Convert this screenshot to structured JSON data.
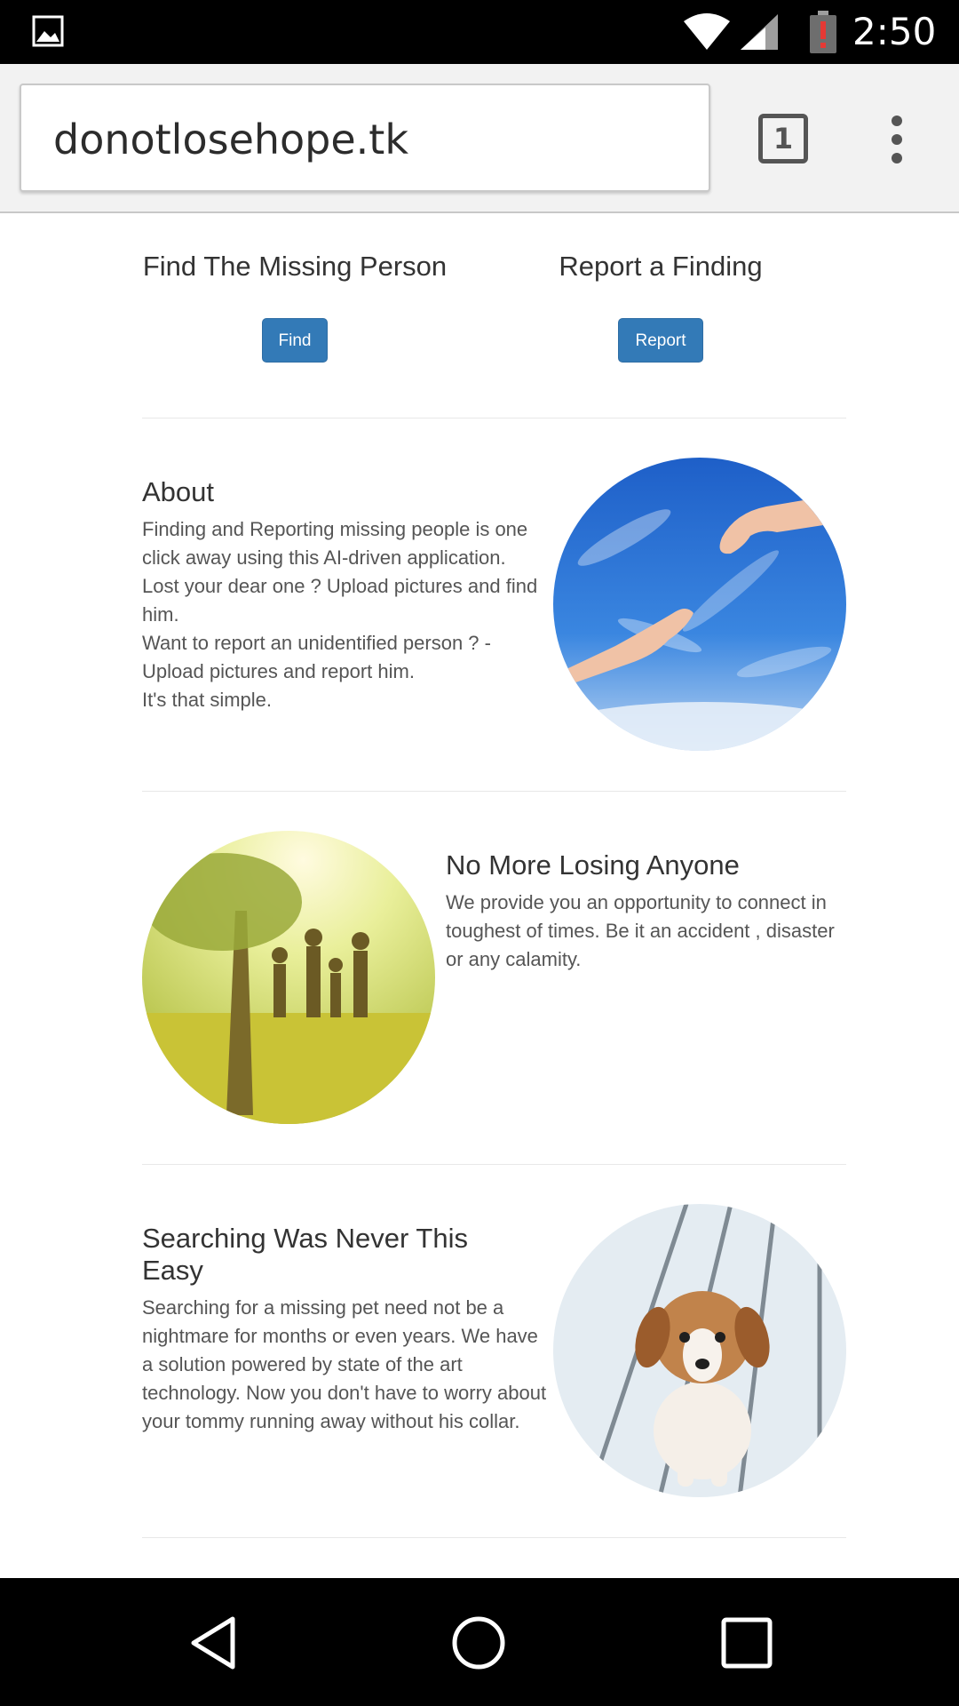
{
  "status_bar": {
    "time": "2:50",
    "icons": [
      "gallery-icon",
      "wifi-icon",
      "signal-icon",
      "battery-alert-icon"
    ]
  },
  "browser": {
    "url": "donotlosehope.tk",
    "tab_count": "1",
    "menu_icon": "overflow-menu-icon"
  },
  "actions": {
    "find": {
      "heading": "Find The Missing Person",
      "button": "Find"
    },
    "report": {
      "heading": "Report a Finding",
      "button": "Report"
    }
  },
  "sections": {
    "about": {
      "title": "About",
      "lines": [
        "Finding and Reporting missing people is one click away using this AI-driven application.",
        "Lost your dear one ? Upload pictures and find him.",
        "Want to report an unidentified person ? - Upload pictures and report him.",
        "It's that simple."
      ]
    },
    "no_more_losing": {
      "title": "No More Losing Anyone",
      "text": "We provide you an opportunity to connect in toughest of times. Be it an accident , disaster or any calamity."
    },
    "searching": {
      "title": "Searching Was Never This Easy",
      "text": "Searching for a missing pet need not be a nightmare for months or even years. We have a solution powered by state of the art technology. Now you don't have to worry about your tommy running away without his collar."
    }
  },
  "colors": {
    "button_primary": "#337ab7",
    "status_bar": "#000000",
    "battery_alert": "#e53935"
  },
  "nav_bar": {
    "icons": [
      "back-icon",
      "home-icon",
      "recents-icon"
    ]
  }
}
